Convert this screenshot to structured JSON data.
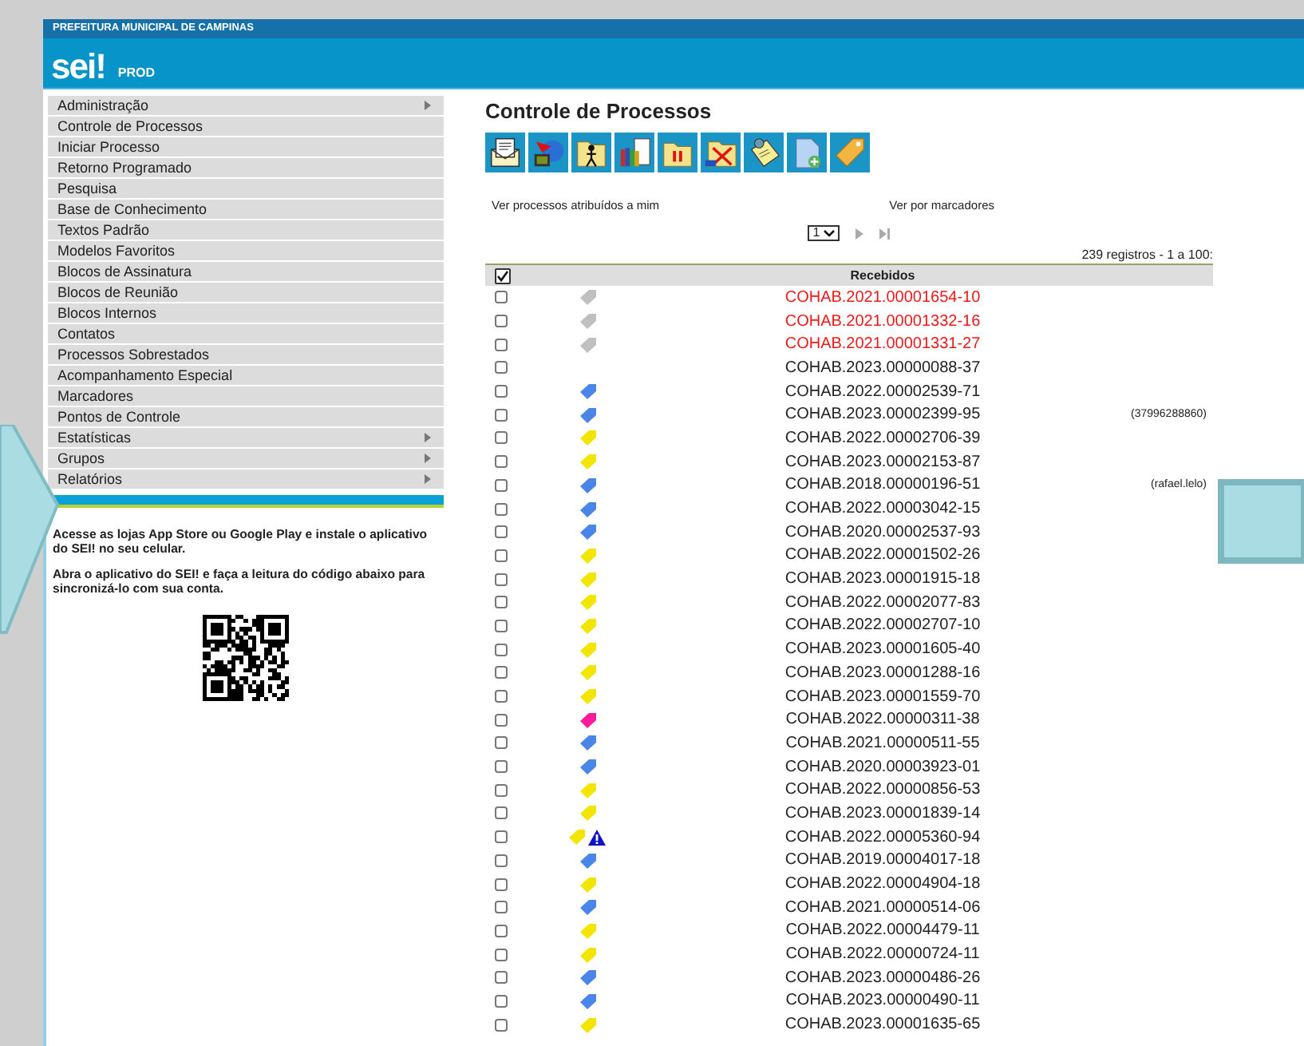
{
  "header": {
    "org": "PREFEITURA MUNICIPAL DE CAMPINAS",
    "logo": "sei!",
    "environment": "PROD"
  },
  "menu": [
    {
      "label": "Administração",
      "submenu": true
    },
    {
      "label": "Controle de Processos",
      "submenu": false
    },
    {
      "label": "Iniciar Processo",
      "submenu": false
    },
    {
      "label": "Retorno Programado",
      "submenu": false
    },
    {
      "label": "Pesquisa",
      "submenu": false
    },
    {
      "label": "Base de Conhecimento",
      "submenu": false
    },
    {
      "label": "Textos Padrão",
      "submenu": false
    },
    {
      "label": "Modelos Favoritos",
      "submenu": false
    },
    {
      "label": "Blocos de Assinatura",
      "submenu": false
    },
    {
      "label": "Blocos de Reunião",
      "submenu": false
    },
    {
      "label": "Blocos Internos",
      "submenu": false
    },
    {
      "label": "Contatos",
      "submenu": false
    },
    {
      "label": "Processos Sobrestados",
      "submenu": false
    },
    {
      "label": "Acompanhamento Especial",
      "submenu": false
    },
    {
      "label": "Marcadores",
      "submenu": false
    },
    {
      "label": "Pontos de Controle",
      "submenu": false
    },
    {
      "label": "Estatísticas",
      "submenu": true
    },
    {
      "label": "Grupos",
      "submenu": true
    },
    {
      "label": "Relatórios",
      "submenu": true
    }
  ],
  "app_info": [
    "Acesse as lojas App Store ou Google Play e instale o aplicativo do SEI! no seu celular.",
    "Abra o aplicativo do SEI! e faça a leitura do código abaixo para sincronizá-lo com sua conta."
  ],
  "title": "Controle de Processos",
  "links": [
    "Ver processos atribuídos a mim",
    "Ver por marcadores"
  ],
  "pager": {
    "page": "1"
  },
  "record_count": "239 registros - 1 a 100:",
  "table": {
    "select_all_checked": true,
    "heading": "Recebidos",
    "rows": [
      {
        "process": "COHAB.2021.00001654-10",
        "new": true,
        "checked": false,
        "color": "#c0c0c0"
      },
      {
        "process": "COHAB.2021.00001332-16",
        "new": true,
        "checked": false,
        "color": "#c0c0c0"
      },
      {
        "process": "COHAB.2021.00001331-27",
        "new": true,
        "checked": false,
        "color": "#c0c0c0"
      },
      {
        "process": "COHAB.2023.00000088-37",
        "new": false,
        "checked": false
      },
      {
        "process": "COHAB.2022.00002539-71",
        "new": false,
        "checked": false,
        "color": "#4a86e8"
      },
      {
        "process": "COHAB.2023.00002399-95",
        "new": false,
        "checked": false,
        "color": "#4a86e8",
        "note": "(37996288860)"
      },
      {
        "process": "COHAB.2022.00002706-39",
        "new": false,
        "checked": false,
        "color": "#f2e600"
      },
      {
        "process": "COHAB.2023.00002153-87",
        "new": false,
        "checked": false,
        "color": "#f2e600"
      },
      {
        "process": "COHAB.2018.00000196-51",
        "new": false,
        "checked": false,
        "color": "#4a86e8",
        "note": "(rafael.lelo)"
      },
      {
        "process": "COHAB.2022.00003042-15",
        "new": false,
        "checked": false,
        "color": "#4a86e8"
      },
      {
        "process": "COHAB.2020.00002537-93",
        "new": false,
        "checked": false,
        "color": "#4a86e8"
      },
      {
        "process": "COHAB.2022.00001502-26",
        "new": false,
        "checked": false,
        "color": "#f2e600"
      },
      {
        "process": "COHAB.2023.00001915-18",
        "new": false,
        "checked": false,
        "color": "#f2e600"
      },
      {
        "process": "COHAB.2022.00002077-83",
        "new": false,
        "checked": false,
        "color": "#f2e600"
      },
      {
        "process": "COHAB.2022.00002707-10",
        "new": false,
        "checked": false,
        "color": "#f2e600"
      },
      {
        "process": "COHAB.2023.00001605-40",
        "new": false,
        "checked": false,
        "color": "#f2e600"
      },
      {
        "process": "COHAB.2023.00001288-16",
        "new": false,
        "checked": false,
        "color": "#f2e600"
      },
      {
        "process": "COHAB.2023.00001559-70",
        "new": false,
        "checked": false,
        "color": "#f2e600"
      },
      {
        "process": "COHAB.2022.00000311-38",
        "new": false,
        "checked": false,
        "color": "#ff1a9c"
      },
      {
        "process": "COHAB.2021.00000511-55",
        "new": false,
        "checked": false,
        "color": "#4a86e8"
      },
      {
        "process": "COHAB.2020.00003923-01",
        "new": false,
        "checked": false,
        "color": "#4a86e8"
      },
      {
        "process": "COHAB.2022.00000856-53",
        "new": false,
        "checked": false,
        "color": "#f2e600"
      },
      {
        "process": "COHAB.2023.00001839-14",
        "new": false,
        "checked": false,
        "color": "#f2e600"
      },
      {
        "process": "COHAB.2022.00005360-94",
        "new": false,
        "checked": false,
        "color": "#f2e600",
        "warning": true
      },
      {
        "process": "COHAB.2019.00004017-18",
        "new": false,
        "checked": false,
        "color": "#4a86e8"
      },
      {
        "process": "COHAB.2022.00004904-18",
        "new": false,
        "checked": false,
        "color": "#f2e600"
      },
      {
        "process": "COHAB.2021.00000514-06",
        "new": false,
        "checked": false,
        "color": "#4a86e8"
      },
      {
        "process": "COHAB.2022.00004479-11",
        "new": false,
        "checked": false,
        "color": "#f2e600"
      },
      {
        "process": "COHAB.2022.00000724-11",
        "new": false,
        "checked": false,
        "color": "#f2e600"
      },
      {
        "process": "COHAB.2023.00000486-26",
        "new": false,
        "checked": false,
        "color": "#4a86e8"
      },
      {
        "process": "COHAB.2023.00000490-11",
        "new": false,
        "checked": false,
        "color": "#4a86e8"
      },
      {
        "process": "COHAB.2023.00001635-65",
        "new": false,
        "checked": false,
        "color": "#f2e600"
      }
    ]
  }
}
